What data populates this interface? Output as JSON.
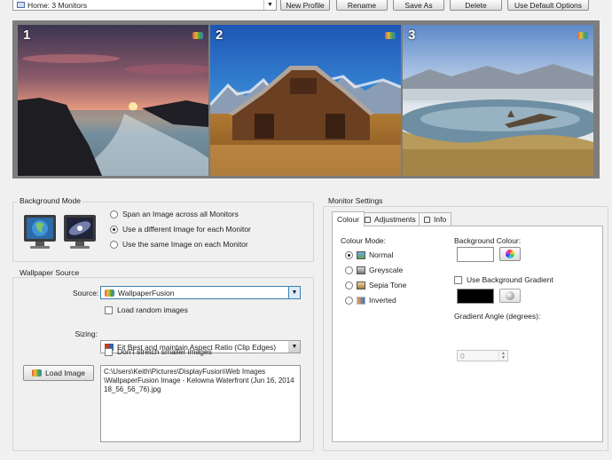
{
  "toolbar": {
    "profile_value": "Home: 3 Monitors",
    "new_profile": "New Profile",
    "rename": "Rename",
    "save_as": "Save As",
    "delete": "Delete",
    "use_default": "Use Default Options"
  },
  "monitors": [
    {
      "number": "1",
      "scene": "sunset seascape with rocks"
    },
    {
      "number": "2",
      "scene": "wooden barn with mountains"
    },
    {
      "number": "3",
      "scene": "lake with driftwood and mountains",
      "selected": true
    }
  ],
  "background_mode": {
    "title": "Background Mode",
    "options": [
      {
        "label": "Span an Image across all Monitors",
        "selected": false
      },
      {
        "label": "Use a different Image for each Monitor",
        "selected": true
      },
      {
        "label": "Use the same Image on each Monitor",
        "selected": false
      }
    ]
  },
  "wallpaper_source": {
    "title": "Wallpaper Source",
    "source_label": "Source:",
    "source_value": "WallpaperFusion",
    "load_random": "Load random images",
    "sizing_label": "Sizing:",
    "sizing_value": "Fit Best and maintain Aspect Ratio (Clip Edges)",
    "dont_stretch": "Don't stretch smaller images",
    "load_image": "Load Image",
    "path": "C:\\Users\\Keith\\Pictures\\DisplayFusion\\Web Images\n\\WallpaperFusion Image - Kelowna Waterfront (Jun 16, 2014\n18_56_56_76).jpg"
  },
  "monitor_settings": {
    "title": "Monitor Settings",
    "tabs": [
      {
        "label": "Colour",
        "active": true
      },
      {
        "label": "Adjustments",
        "active": false
      },
      {
        "label": "Info",
        "active": false
      }
    ],
    "colour_mode_label": "Colour Mode:",
    "modes": [
      {
        "label": "Normal",
        "selected": true
      },
      {
        "label": "Greyscale",
        "selected": false
      },
      {
        "label": "Sepia Tone",
        "selected": false
      },
      {
        "label": "Inverted",
        "selected": false
      }
    ],
    "background_colour_label": "Background Colour:",
    "background_colour": "#ffffff",
    "use_gradient": "Use Background Gradient",
    "gradient_colour": "#000000",
    "gradient_angle_label": "Gradient Angle (degrees):",
    "gradient_angle_value": "0"
  },
  "colors": {
    "selected_monitor_border": "#d2232a",
    "monitor_strip_bg": "#7d7d7d",
    "window_bg": "#f0f0f0"
  }
}
